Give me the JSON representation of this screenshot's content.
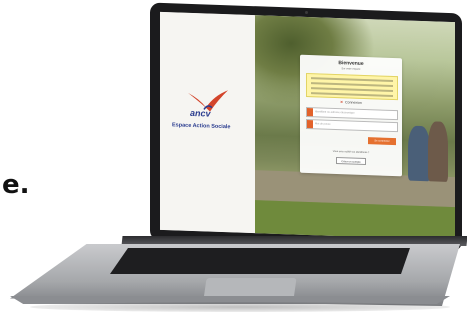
{
  "page_fragment": "e.",
  "left_panel": {
    "logo_name": "ancv",
    "tagline": "Espace Action Sociale"
  },
  "login_card": {
    "title": "Bienvenue",
    "subtitle": "Sur votre espace",
    "connect_heading": "Connexion",
    "username_placeholder": "Identifiant ou adresse électronique",
    "password_placeholder": "Mot de passe",
    "connect_button": "Se connecter",
    "forgot_link": "Vous avez oublié vos identifiants ?",
    "create_account_button": "Créer un compte"
  },
  "colors": {
    "brand_blue": "#2a3c8f",
    "brand_red": "#d3442b",
    "accent_orange": "#e5702f",
    "notice_yellow": "#fff5a8"
  },
  "icons": {
    "logo": "bird-logo-icon",
    "user_field": "user-icon",
    "password_field": "lock-icon"
  }
}
